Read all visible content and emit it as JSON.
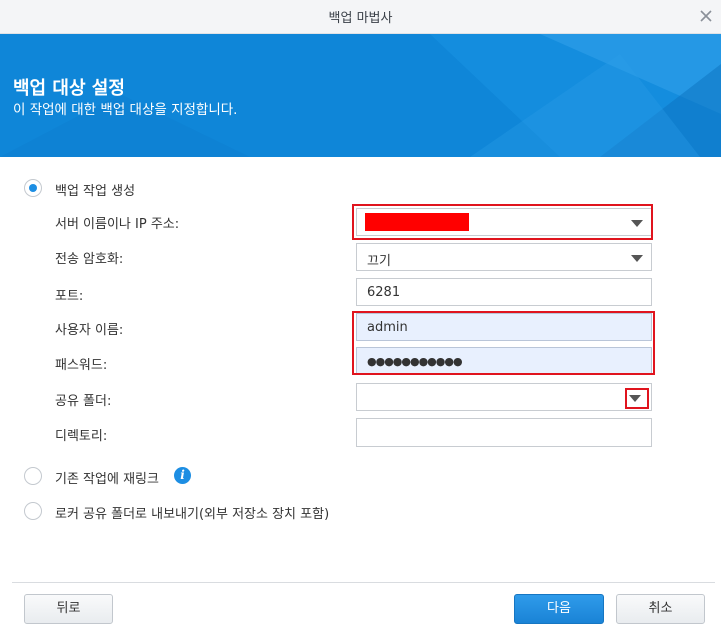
{
  "window": {
    "title": "백업 마법사"
  },
  "header": {
    "title": "백업 대상 설정",
    "subtitle": "이 작업에 대한 백업 대상을 지정합니다."
  },
  "options": {
    "create_job": "백업 작업 생성",
    "relink_existing": "기존 작업에 재링크",
    "export_locker": "로커 공유 폴더로 내보내기(외부 저장소 장치 포함)"
  },
  "form": {
    "server_label": "서버 이름이나 IP 주소:",
    "server_value": "",
    "encryption_label": "전송 암호화:",
    "encryption_value": "끄기",
    "port_label": "포트:",
    "port_value": "6281",
    "username_label": "사용자 이름:",
    "username_value": "admin",
    "password_label": "패스워드:",
    "password_value": "●●●●●●●●●●●",
    "shared_folder_label": "공유 폴더:",
    "shared_folder_value": "",
    "directory_label": "디렉토리:",
    "directory_value": ""
  },
  "buttons": {
    "back": "뒤로",
    "next": "다음",
    "cancel": "취소"
  },
  "colors": {
    "accent": "#1d8ee3",
    "banner": "#0f86d8",
    "highlight": "#e0141e",
    "redacted": "#ff0000"
  }
}
